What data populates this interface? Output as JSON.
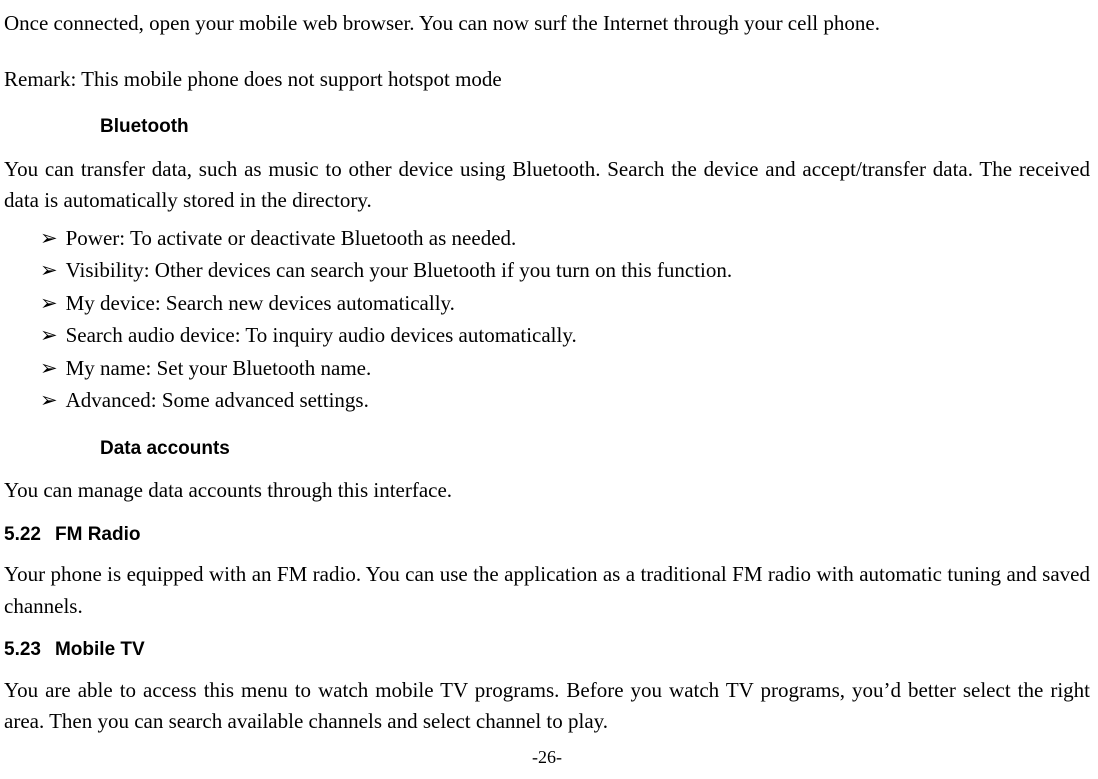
{
  "intro_para": "Once connected, open your mobile web browser. You can now surf the Internet through your cell phone.",
  "remark": "Remark: This mobile phone does not support hotspot mode",
  "bluetooth": {
    "heading": "Bluetooth",
    "para": "You can transfer data, such as music to other device using Bluetooth. Search the device and accept/transfer data. The received data is automatically stored in the directory.",
    "items": [
      "Power: To activate or deactivate Bluetooth as needed.",
      "Visibility: Other devices can search your Bluetooth if you turn on this function.",
      "My device: Search new devices automatically.",
      "Search audio device: To inquiry audio devices automatically.",
      "My name: Set your Bluetooth name.",
      "Advanced: Some advanced settings."
    ]
  },
  "data_accounts": {
    "heading": "Data accounts",
    "para": "You can manage data accounts through this interface."
  },
  "fm_radio": {
    "number": "5.22",
    "title": "FM Radio",
    "para": "Your phone is equipped with an FM radio. You can use the application as a traditional FM radio with automatic tuning and saved channels."
  },
  "mobile_tv": {
    "number": "5.23",
    "title": "Mobile TV",
    "para": "You are able to access this menu to watch mobile TV programs. Before you watch TV programs, you’d better select the right area. Then you can search available channels and select channel to play."
  },
  "page_number": "-26-",
  "bullet_glyph": "➢"
}
